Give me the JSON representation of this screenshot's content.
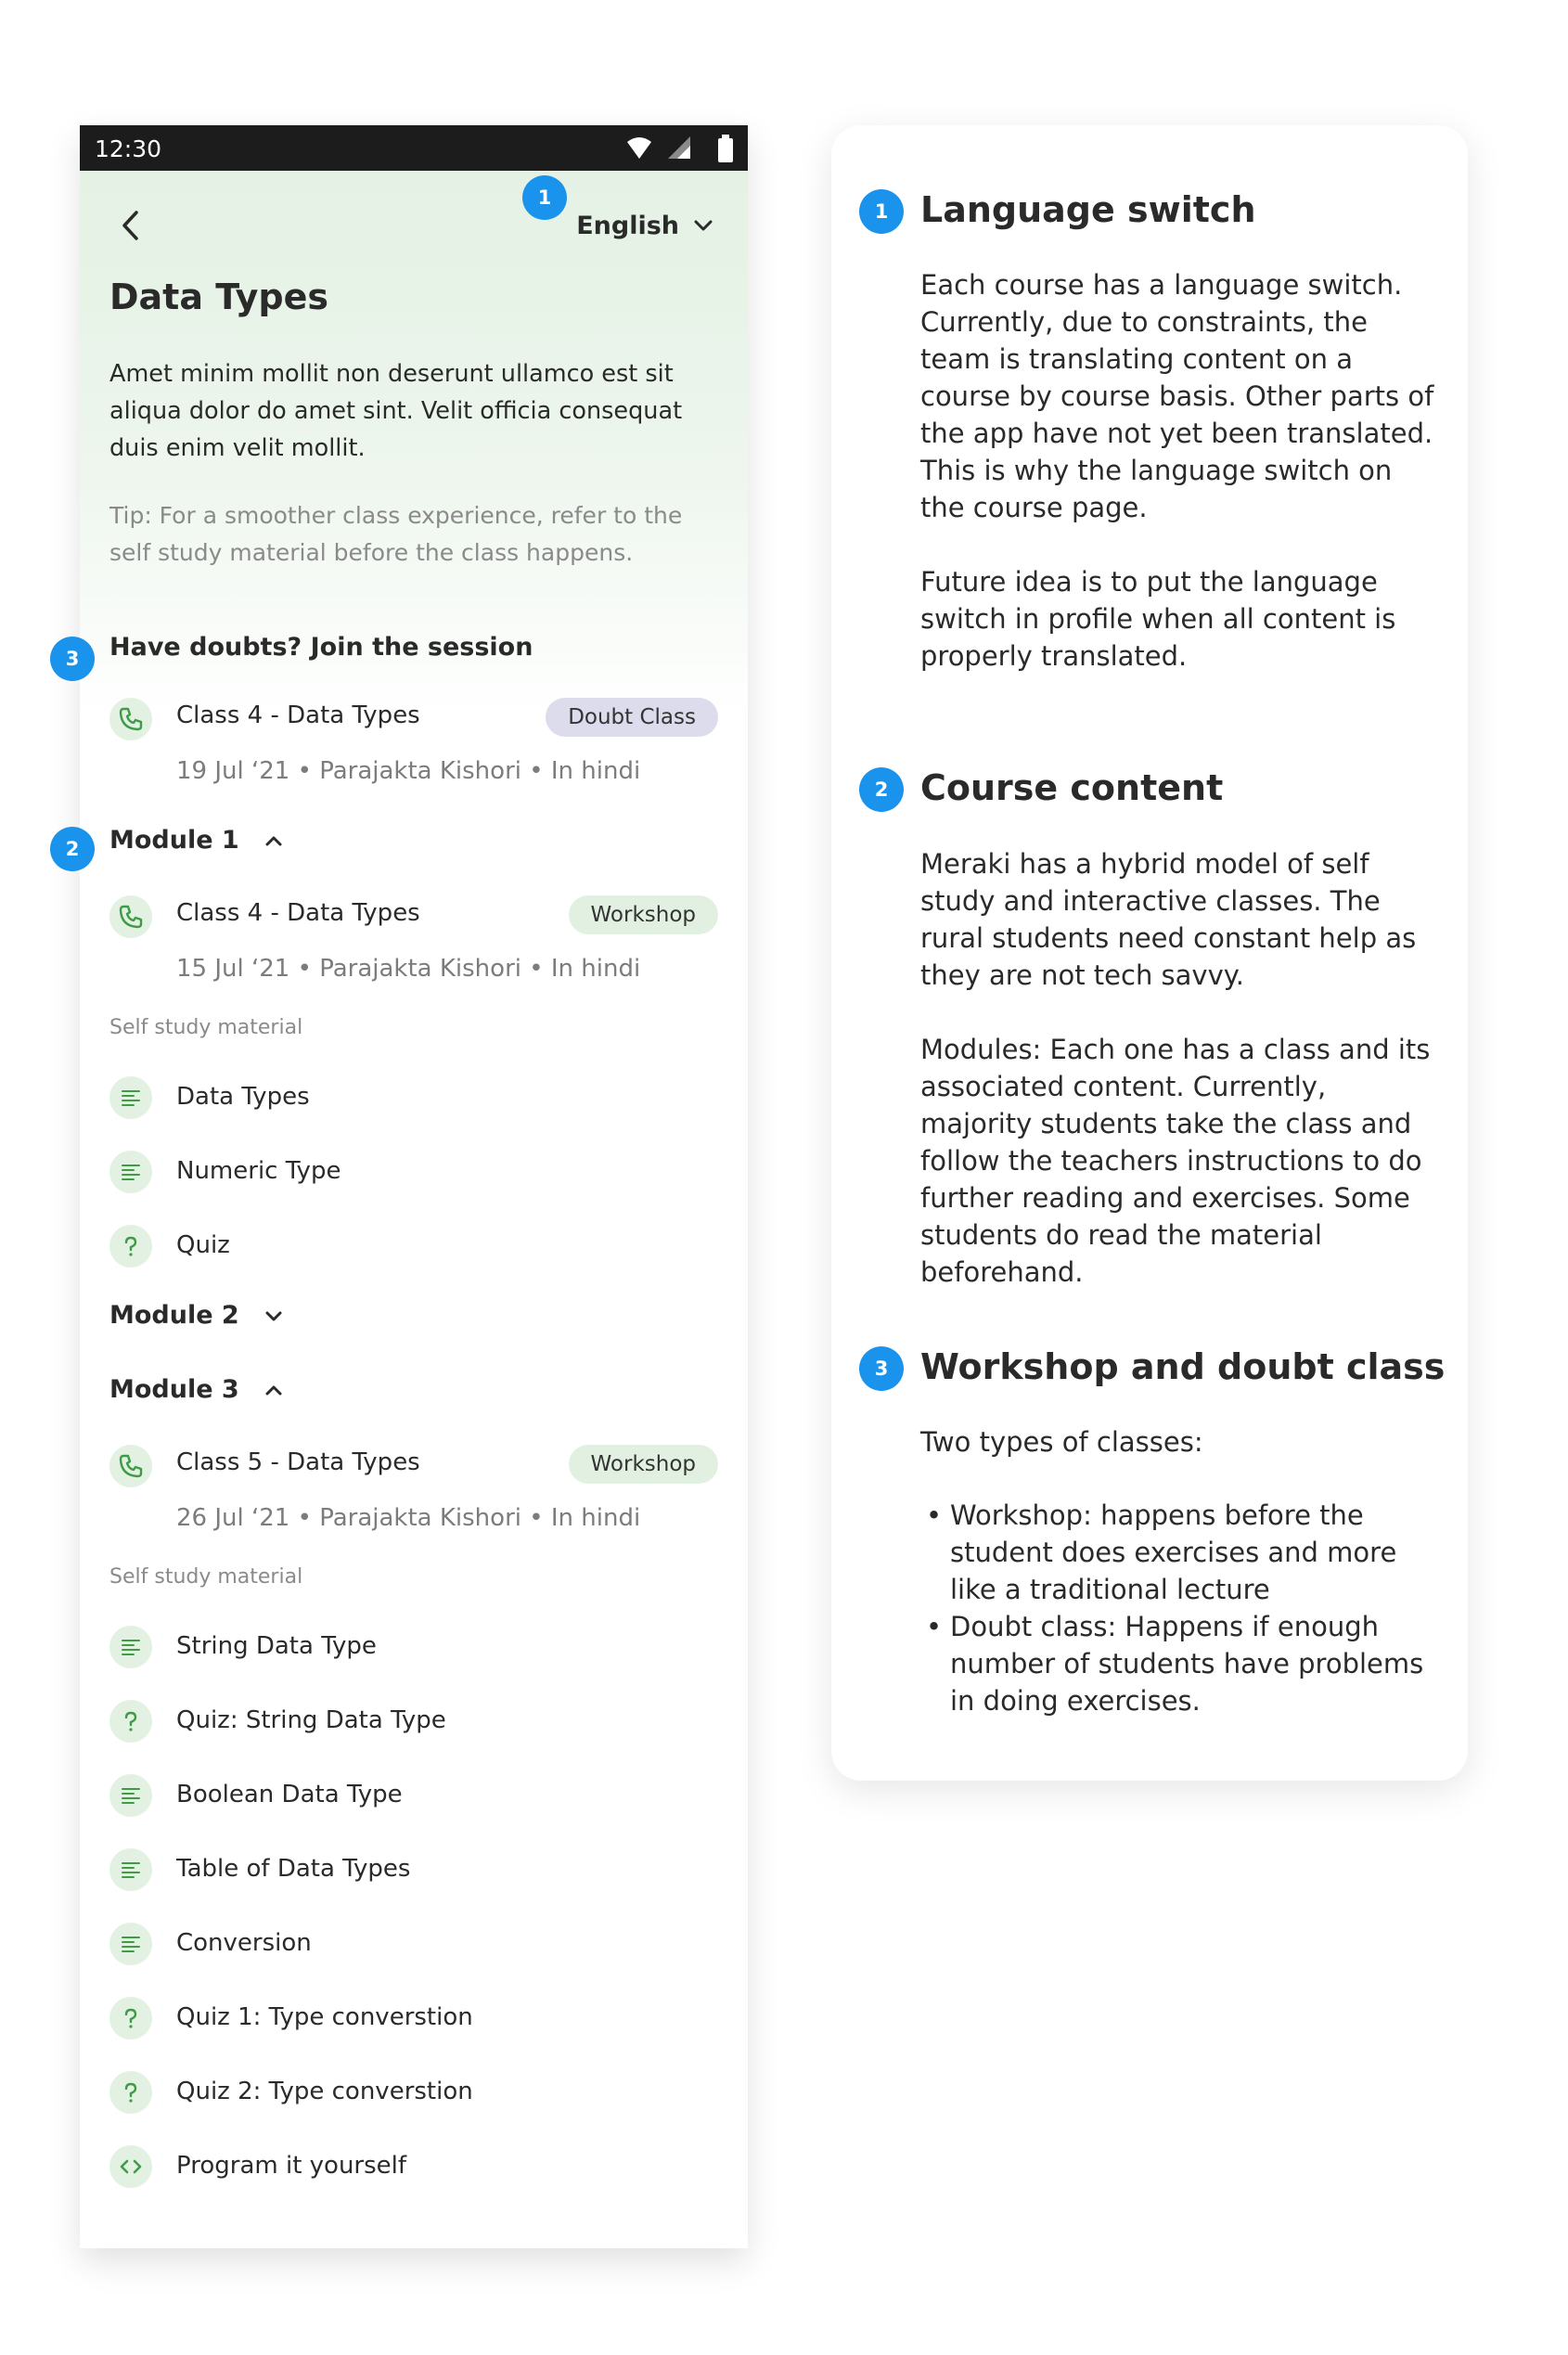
{
  "status": {
    "time": "12:30"
  },
  "header": {
    "language": "English",
    "title": "Data Types",
    "description": "Amet minim mollit non deserunt ullamco est sit aliqua dolor do amet sint. Velit officia consequat duis enim velit mollit.",
    "tip": "Tip: For a smoother class experience, refer to the self study material before the class happens."
  },
  "markers": [
    "1",
    "2",
    "3"
  ],
  "doubts": {
    "heading": "Have doubts? Join the session",
    "class": {
      "title": "Class 4 - Data Types",
      "badge": "Doubt Class",
      "meta": "19 Jul ‘21  •  Parajakta Kishori  •  In hindi"
    }
  },
  "modules": [
    {
      "name": "Module 1",
      "expanded": true,
      "class": {
        "title": "Class 4 - Data Types",
        "badge": "Workshop",
        "meta": "15 Jul ‘21  •  Parajakta Kishori  •  In hindi"
      },
      "material_label": "Self study material",
      "materials": [
        {
          "label": "Data Types",
          "icon": "document-icon"
        },
        {
          "label": "Numeric Type",
          "icon": "document-icon"
        },
        {
          "label": "Quiz",
          "icon": "question-icon"
        }
      ]
    },
    {
      "name": "Module 2",
      "expanded": false
    },
    {
      "name": "Module 3",
      "expanded": true,
      "class": {
        "title": "Class 5 - Data Types",
        "badge": "Workshop",
        "meta": "26 Jul ‘21  •  Parajakta Kishori  •  In hindi"
      },
      "material_label": "Self study material",
      "materials": [
        {
          "label": "String Data Type",
          "icon": "document-icon"
        },
        {
          "label": "Quiz: String Data Type",
          "icon": "question-icon"
        },
        {
          "label": "Boolean Data Type",
          "icon": "document-icon"
        },
        {
          "label": "Table of Data Types",
          "icon": "document-icon"
        },
        {
          "label": "Conversion",
          "icon": "document-icon"
        },
        {
          "label": "Quiz 1: Type converstion",
          "icon": "question-icon"
        },
        {
          "label": "Quiz 2: Type converstion",
          "icon": "question-icon"
        },
        {
          "label": "Program it yourself",
          "icon": "code-icon"
        }
      ]
    }
  ],
  "notes": [
    {
      "number": "1",
      "title": "Language switch",
      "paragraphs": [
        "Each course has a language switch. Currently, due to constraints, the team is translating content on a course by course basis. Other parts of the app have not yet been translated. This is why the language switch on the course page.",
        "Future idea is to put the language switch in profile when all content is properly translated."
      ]
    },
    {
      "number": "2",
      "title": "Course content",
      "paragraphs": [
        "Meraki has a hybrid model of self study and interactive classes. The rural students need constant help as they are not tech savvy.",
        "Modules: Each one has a class and its associated content. Currently, majority students take the class and follow the teachers instructions to do further reading and exercises. Some students do read the material beforehand."
      ]
    },
    {
      "number": "3",
      "title": "Workshop and doubt class",
      "intro": "Two types of classes:",
      "bullets": [
        "Workshop: happens before the student does exercises and more like a traditional lecture",
        "Doubt class: Happens if enough number of students have problems in doing exercises."
      ]
    }
  ],
  "colors": {
    "accent_blue": "#1a93ec",
    "icon_green": "#3f9b46",
    "icon_bg": "#e3f1e3",
    "doubt_badge": "#dddced",
    "workshop_badge": "#e2f0e2"
  }
}
